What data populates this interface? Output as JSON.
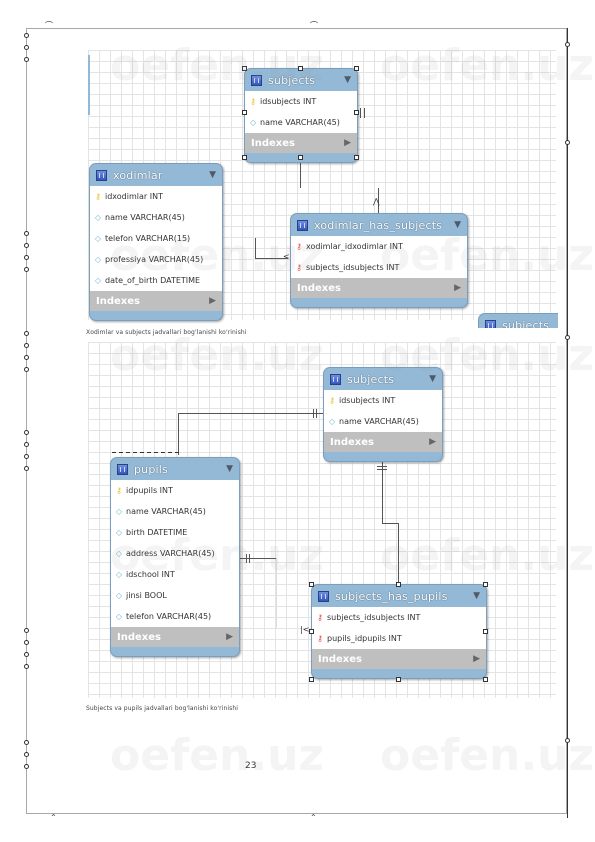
{
  "diagram1": {
    "tables": {
      "subjects": {
        "name": "subjects",
        "columns": [
          {
            "icon": "primary-key-icon",
            "text": "idsubjects INT"
          },
          {
            "icon": "column-icon",
            "text": "name VARCHAR(45)"
          }
        ],
        "indexes_label": "Indexes"
      },
      "xodimlar": {
        "name": "xodimlar",
        "columns": [
          {
            "icon": "primary-key-icon",
            "text": "idxodimlar INT"
          },
          {
            "icon": "column-icon",
            "text": "name VARCHAR(45)"
          },
          {
            "icon": "column-icon",
            "text": "telefon VARCHAR(15)"
          },
          {
            "icon": "column-icon",
            "text": "professiya VARCHAR(45)"
          },
          {
            "icon": "column-icon",
            "text": "date_of_birth DATETIME"
          }
        ],
        "indexes_label": "Indexes"
      },
      "xodimlar_has_subjects": {
        "name": "xodimlar_has_subjects",
        "columns": [
          {
            "icon": "foreign-key-icon",
            "text": "xodimlar_idxodimlar INT"
          },
          {
            "icon": "foreign-key-icon",
            "text": "subjects_idsubjects INT"
          }
        ],
        "indexes_label": "Indexes"
      },
      "partial": {
        "name": "subjects"
      }
    },
    "caption": "Xodimlar va subjects jadvallari bog'lanishi ko'rinishi"
  },
  "diagram2": {
    "tables": {
      "subjects": {
        "name": "subjects",
        "columns": [
          {
            "icon": "primary-key-icon",
            "text": "idsubjects INT"
          },
          {
            "icon": "column-icon",
            "text": "name VARCHAR(45)"
          }
        ],
        "indexes_label": "Indexes"
      },
      "pupils": {
        "name": "pupils",
        "columns": [
          {
            "icon": "primary-key-icon",
            "text": "idpupils INT"
          },
          {
            "icon": "column-icon",
            "text": "name VARCHAR(45)"
          },
          {
            "icon": "column-icon",
            "text": "birth DATETIME"
          },
          {
            "icon": "column-icon",
            "text": "address VARCHAR(45)"
          },
          {
            "icon": "column-icon",
            "text": "idschool INT"
          },
          {
            "icon": "column-icon",
            "text": "jinsi BOOL"
          },
          {
            "icon": "column-icon",
            "text": "telefon VARCHAR(45)"
          }
        ],
        "indexes_label": "Indexes"
      },
      "subjects_has_pupils": {
        "name": "subjects_has_pupils",
        "columns": [
          {
            "icon": "foreign-key-icon",
            "text": "subjects_idsubjects INT"
          },
          {
            "icon": "foreign-key-icon",
            "text": "pupils_idpupils INT"
          }
        ],
        "indexes_label": "Indexes"
      }
    },
    "caption": "Subjects va pupils jadvallari bog'lanishi ko'rinishi"
  },
  "page_number": "23",
  "watermark": "oefen.uz",
  "colors": {
    "table_header": "#93b9d6",
    "indexes_bar": "#bfbfbf",
    "primary_key": "#e8c22a",
    "foreign_key": "#d9534f",
    "column": "#6fb7d0"
  }
}
